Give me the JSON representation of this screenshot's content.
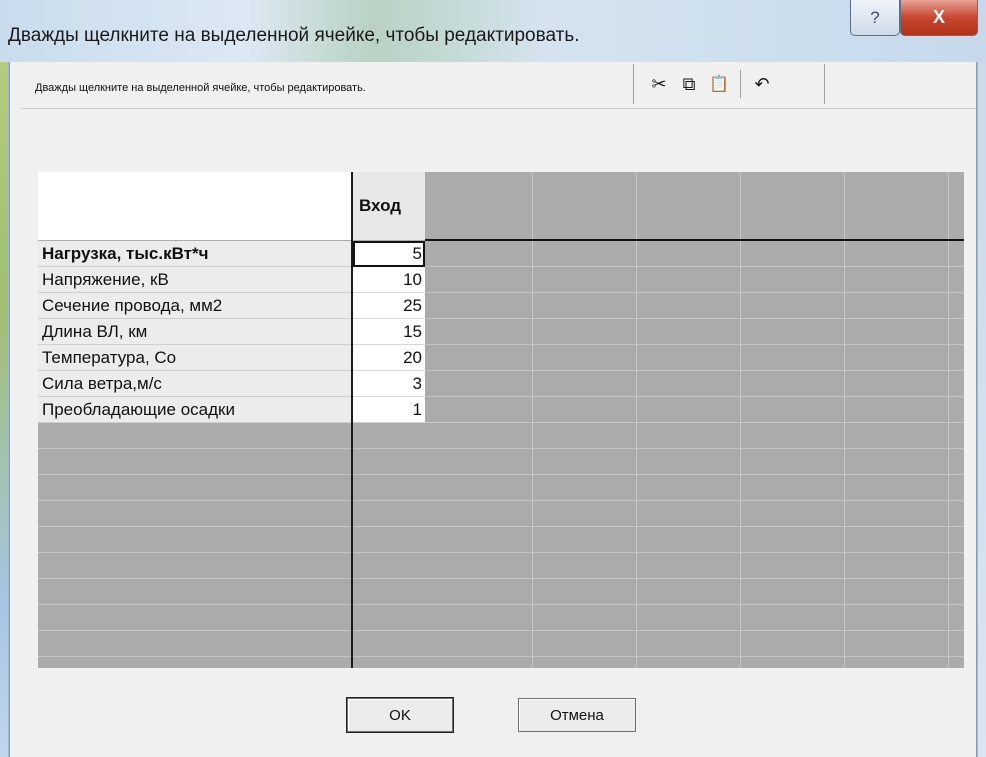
{
  "window": {
    "title": "Дважды щелкните на выделенной ячейке, чтобы редактировать.",
    "help_glyph": "?",
    "close_glyph": "X"
  },
  "hint": "Дважды щелкните на выделенной ячейке, чтобы редактировать.",
  "toolbar": {
    "cut_icon": "✂",
    "copy_icon": "⧉",
    "paste_icon": "📋",
    "undo_icon": "↶"
  },
  "grid": {
    "column_header": "Вход",
    "rows": [
      {
        "label": "Нагрузка, тыс.кВт*ч",
        "value": "5"
      },
      {
        "label": "Напряжение, кВ",
        "value": "10"
      },
      {
        "label": "Сечение провода, мм2",
        "value": "25"
      },
      {
        "label": "Длина ВЛ, км",
        "value": "15"
      },
      {
        "label": "Температура, Со",
        "value": "20"
      },
      {
        "label": "Сила ветра,м/с",
        "value": "3"
      },
      {
        "label": "Преобладающие осадки",
        "value": "1"
      }
    ]
  },
  "buttons": {
    "ok": "OK",
    "cancel": "Отмена"
  }
}
